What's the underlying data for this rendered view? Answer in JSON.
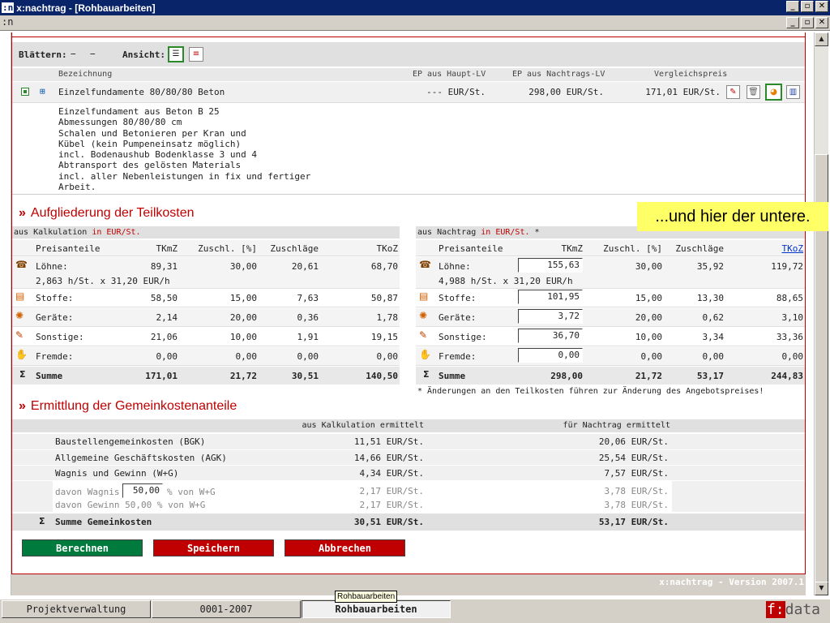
{
  "titlebar": {
    "logo": ":n",
    "title": "x:nachtrag - [Rohbauarbeiten]"
  },
  "menubar": {
    "logo": ":n"
  },
  "toolbar": {
    "blaettern_label": "Blättern:",
    "blaettern_prev": "−",
    "blaettern_next": "−",
    "ansicht_label": "Ansicht:"
  },
  "lv_header": {
    "bezeichnung": "Bezeichnung",
    "ep_haupt": "EP aus Haupt-LV",
    "ep_nachtrag": "EP aus Nachtrags-LV",
    "vergleich": "Vergleichspreis"
  },
  "position": {
    "title": "Einzelfundamente 80/80/80 Beton",
    "ep_haupt": "--- EUR/St.",
    "ep_nachtrag": "298,00 EUR/St.",
    "vergleich": "171,01 EUR/St.",
    "description": [
      "Einzelfundament aus Beton B 25",
      "Abmessungen 80/80/80 cm",
      "Schalen und Betonieren per Kran und",
      "Kübel (kein Pumpeneinsatz möglich)",
      "incl. Bodenaushub Bodenklasse 3 und 4",
      "Abtransport des gelösten Materials",
      "incl. aller Nebenleistungen in fix und fertiger",
      "Arbeit."
    ]
  },
  "teilkosten": {
    "title": "Aufgliederung der Teilkosten",
    "left_caption": "aus Kalkulation",
    "left_caption_red": "in EUR/St.",
    "right_caption": "aus Nachtrag",
    "right_caption_red": "in EUR/St.",
    "right_caption_star": "*",
    "cols": [
      "Preisanteile",
      "TKmZ",
      "Zuschl. [%]",
      "Zuschläge",
      "TKoZ"
    ],
    "left_rows": [
      {
        "label": "Löhne:",
        "tkmz": "89,31",
        "zuschl": "30,00",
        "zuschlaege": "20,61",
        "tkoz": "68,70",
        "sub": "2,863 h/St. x 31,20 EUR/h"
      },
      {
        "label": "Stoffe:",
        "tkmz": "58,50",
        "zuschl": "15,00",
        "zuschlaege": "7,63",
        "tkoz": "50,87"
      },
      {
        "label": "Geräte:",
        "tkmz": "2,14",
        "zuschl": "20,00",
        "zuschlaege": "0,36",
        "tkoz": "1,78"
      },
      {
        "label": "Sonstige:",
        "tkmz": "21,06",
        "zuschl": "10,00",
        "zuschlaege": "1,91",
        "tkoz": "19,15"
      },
      {
        "label": "Fremde:",
        "tkmz": "0,00",
        "zuschl": "0,00",
        "zuschlaege": "0,00",
        "tkoz": "0,00"
      }
    ],
    "left_sum": {
      "label": "Summe",
      "tkmz": "171,01",
      "zuschl": "21,72",
      "zuschlaege": "30,51",
      "tkoz": "140,50"
    },
    "right_rows": [
      {
        "label": "Löhne:",
        "tkmz": "155,63",
        "zuschl": "30,00",
        "zuschlaege": "35,92",
        "tkoz": "119,72",
        "sub": "4,988 h/St. x 31,20 EUR/h"
      },
      {
        "label": "Stoffe:",
        "tkmz": "101,95",
        "zuschl": "15,00",
        "zuschlaege": "13,30",
        "tkoz": "88,65"
      },
      {
        "label": "Geräte:",
        "tkmz": "3,72",
        "zuschl": "20,00",
        "zuschlaege": "0,62",
        "tkoz": "3,10"
      },
      {
        "label": "Sonstige:",
        "tkmz": "36,70",
        "zuschl": "10,00",
        "zuschlaege": "3,34",
        "tkoz": "33,36"
      },
      {
        "label": "Fremde:",
        "tkmz": "0,00",
        "zuschl": "0,00",
        "zuschlaege": "0,00",
        "tkoz": "0,00"
      }
    ],
    "right_sum": {
      "label": "Summe",
      "tkmz": "298,00",
      "zuschl": "21,72",
      "zuschlaege": "53,17",
      "tkoz": "244,83"
    },
    "footnote": "* Änderungen an den Teilkosten führen zur Änderung des Angebotspreises!"
  },
  "gemeinkosten": {
    "title": "Ermittlung der Gemeinkostenanteile",
    "col_kalk": "aus Kalkulation ermittelt",
    "col_nachtrag": "für Nachtrag ermittelt",
    "rows": [
      {
        "label": "Baustellengemeinkosten (BGK)",
        "kalk": "11,51 EUR/St.",
        "nachtrag": "20,06 EUR/St."
      },
      {
        "label": "Allgemeine Geschäftskosten (AGK)",
        "kalk": "14,66 EUR/St.",
        "nachtrag": "25,54 EUR/St."
      },
      {
        "label": "Wagnis und Gewinn (W+G)",
        "kalk": "4,34 EUR/St.",
        "nachtrag": "7,57 EUR/St."
      }
    ],
    "wagnis_prefix": "davon Wagnis",
    "wagnis_value": "50,00",
    "wagnis_suffix": "% von W+G",
    "wagnis_kalk": "2,17 EUR/St.",
    "wagnis_nachtrag": "3,78 EUR/St.",
    "gewinn_label": "davon Gewinn 50,00 % von W+G",
    "gewinn_kalk": "2,17 EUR/St.",
    "gewinn_nachtrag": "3,78 EUR/St.",
    "sum_label": "Summe Gemeinkosten",
    "sum_kalk": "30,51 EUR/St.",
    "sum_nachtrag": "53,17 EUR/St."
  },
  "buttons": {
    "berechnen": "Berechnen",
    "speichern": "Speichern",
    "abbrechen": "Abbrechen"
  },
  "colors": {
    "green": "#007a3d",
    "red": "#c00000"
  },
  "callout": "...und hier der untere.",
  "version": "x:nachtrag - Version 2007.1",
  "tooltip": "Rohbauarbeiten",
  "taskbar": {
    "tab1": "Projektverwaltung",
    "tab2": "0001-2007",
    "tab3": "Rohbauarbeiten",
    "brand_f": "f:",
    "brand_data": "data"
  }
}
